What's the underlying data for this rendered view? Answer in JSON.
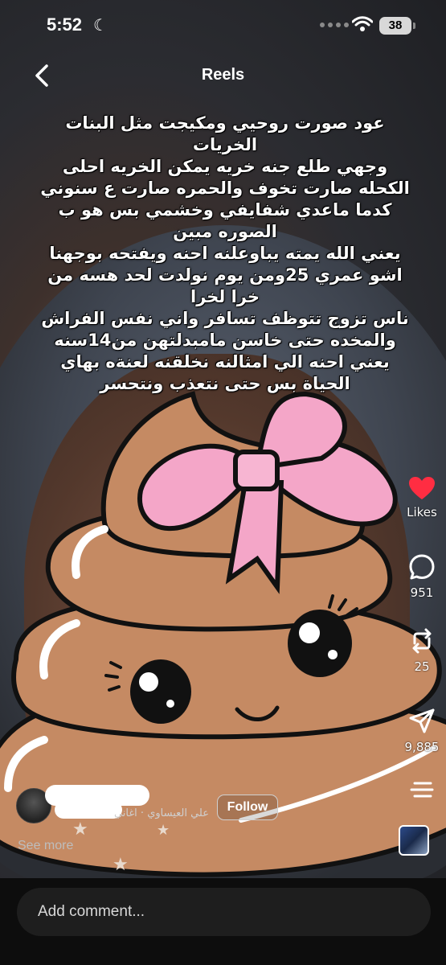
{
  "status_bar": {
    "time": "5:52",
    "battery": "38"
  },
  "header": {
    "title": "Reels"
  },
  "caption": {
    "lines": [
      "عود صورت روحيي ومكيجت مثل البنات",
      "الخريات",
      "وجهي طلع جنه خريه يمكن الخريه احلى",
      "الكحله صارت تخوف والحمره صارت ع سنوني",
      "كدما ماعدي شفايفي وخشمي بس هو ب",
      "الصوره مبين",
      "يعني الله يمته يباوعلنه احنه ويفتحه بوجهنا",
      "اشو عمري 25ومن يوم نولدت لحد هسه من",
      "خرا لخرا",
      "ناس تزوج تتوظف تسافر واني نفس الفراش",
      "والمخده حتى خاسن مامبدلتهن من14سنه",
      "يعني احنه الي امثالنه نخلقنه لعنةه بهاي",
      "الحياة بس حتى نتعذب ونتحسر"
    ]
  },
  "actions": {
    "likes_label": "Likes",
    "comments_count": "951",
    "reposts_count": "25",
    "shares_count": "9,885",
    "like_color": "#ff2d42"
  },
  "author": {
    "subtitle": "علي العيساوي · اغاني",
    "follow_label": "Follow",
    "see_more": "See more"
  },
  "comment": {
    "placeholder": "Add comment..."
  }
}
